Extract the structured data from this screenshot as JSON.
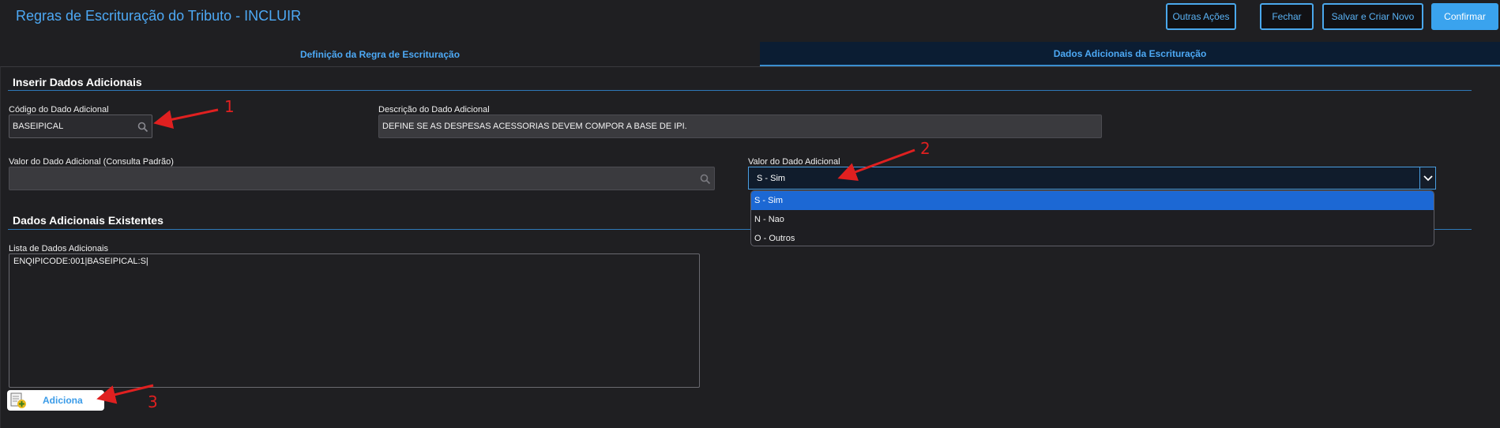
{
  "header": {
    "title": "Regras de Escrituração do Tributo - INCLUIR",
    "buttons": {
      "other_actions": "Outras Ações",
      "close": "Fechar",
      "save_new": "Salvar e Criar Novo",
      "confirm": "Confirmar"
    }
  },
  "tabs": [
    {
      "label": "Definição da Regra de Escrituração",
      "active": false
    },
    {
      "label": "Dados Adicionais da Escrituração",
      "active": true
    }
  ],
  "insert_section": {
    "title": "Inserir Dados Adicionais",
    "code_label": "Código do Dado Adicional",
    "code_value": "BASEIPICAL",
    "description_label": "Descrição do Dado Adicional",
    "description_value": "DEFINE SE AS DESPESAS ACESSORIAS DEVEM COMPOR A BASE DE IPI.",
    "value_query_label": "Valor do Dado Adicional (Consulta Padrão)",
    "value_query_value": "",
    "value_label": "Valor do Dado Adicional",
    "value_selected": "S - Sim",
    "options": [
      "S - Sim",
      "N - Nao",
      "O - Outros"
    ]
  },
  "existing_section": {
    "title": "Dados Adicionais Existentes",
    "list_label": "Lista de Dados Adicionais",
    "list_value": "ENQIPICODE:001|BASEIPICAL:S|"
  },
  "add_button": {
    "label": "Adiciona"
  },
  "annotations": [
    "1",
    "2",
    "3"
  ],
  "colors": {
    "accent": "#4da9f5",
    "annotation": "#e02020",
    "selected_option": "#1c68d4"
  }
}
